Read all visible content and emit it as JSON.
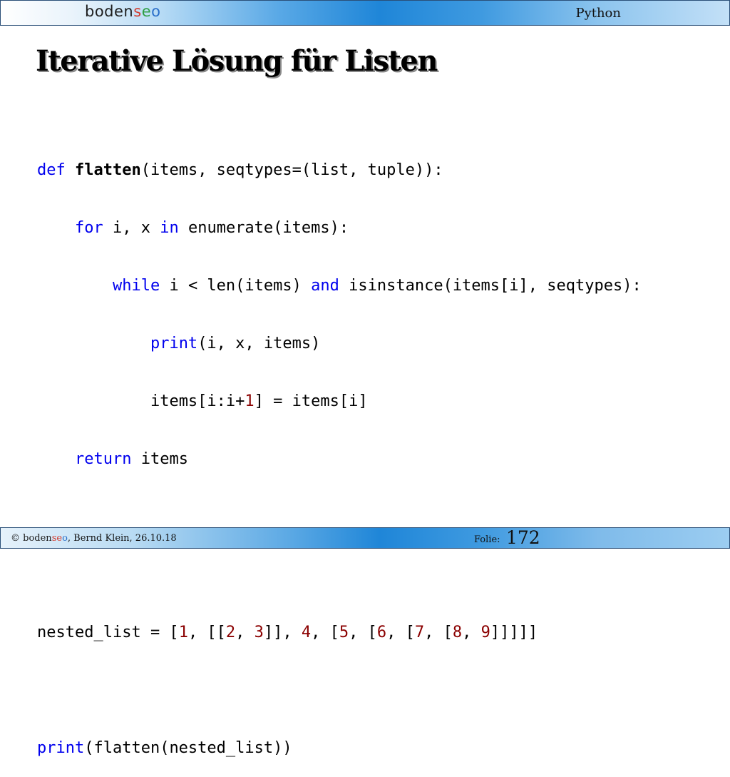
{
  "header": {
    "logo": {
      "part1": "boden",
      "part2": "s",
      "part3": "e",
      "part4": "o"
    },
    "section": "Python"
  },
  "slide": {
    "title": "Iterative Lösung für Listen"
  },
  "code": {
    "l1": {
      "kw_def": "def",
      "fn_name": "flatten",
      "rest": "(items, seqtypes=(list, tuple)):"
    },
    "l2": {
      "indent": "    ",
      "kw_for": "for",
      "mid1": " i, x ",
      "kw_in": "in",
      "rest": " enumerate(items):"
    },
    "l3": {
      "indent": "        ",
      "kw_while": "while",
      "mid1": " i < len(items) ",
      "kw_and": "and",
      "rest": " isinstance(items[i], seqtypes):"
    },
    "l4": {
      "indent": "            ",
      "bi_print": "print",
      "rest": "(i, x, items)"
    },
    "l5": {
      "indent": "            ",
      "pre": "items[i:i+",
      "num": "1",
      "rest": "] = items[i]"
    },
    "l6": {
      "indent": "    ",
      "kw_return": "return",
      "rest": " items"
    },
    "l9": {
      "t0": "nested_list = [",
      "n1": "1",
      "t1": ", [[",
      "n2": "2",
      "t2": ", ",
      "n3": "3",
      "t3": "]], ",
      "n4": "4",
      "t4": ", [",
      "n5": "5",
      "t5": ", [",
      "n6": "6",
      "t6": ", [",
      "n7": "7",
      "t7": ", [",
      "n8": "8",
      "t8": ", ",
      "n9": "9",
      "t9": "]]]]]"
    },
    "l11": {
      "bi_print": "print",
      "rest": "(flatten(nested_list))"
    }
  },
  "footer": {
    "copyright": "© ",
    "logo": {
      "part1": "boden",
      "part2": "s",
      "part3": "e",
      "part4": "o"
    },
    "author": ", Bernd Klein, 26.10.18",
    "folie_label": "Folie:",
    "folie_number": "172"
  }
}
